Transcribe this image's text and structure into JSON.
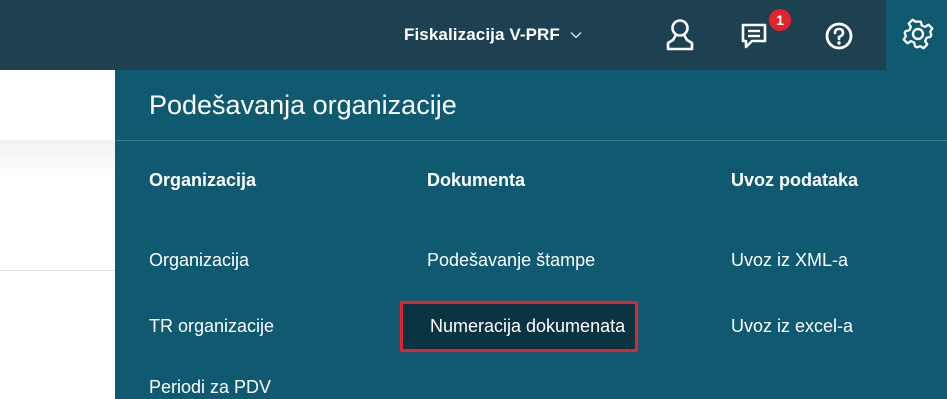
{
  "header": {
    "org_name": "Fiskalizacija V-PRF",
    "notification_count": "1"
  },
  "icons": {
    "user": "user-icon",
    "messages": "messages-icon",
    "help": "help-icon",
    "settings": "gear-icon",
    "org_dropdown": "chevron-down-icon"
  },
  "colors": {
    "topbar": "#1d4150",
    "panel": "#0f5a70",
    "highlight_bg": "#0a3441",
    "highlight_border": "#e3222b",
    "badge": "#e3222b"
  },
  "panel": {
    "title": "Podešavanja organizacije",
    "columns": [
      {
        "heading": "Organizacija",
        "items": [
          "Organizacija",
          "TR organizacije",
          "Periodi za PDV"
        ]
      },
      {
        "heading": "Dokumenta",
        "items": [
          "Podešavanje štampe",
          "Numeracija dokumenata"
        ]
      },
      {
        "heading": "Uvoz podataka",
        "items": [
          "Uvoz iz XML-a",
          "Uvoz iz excel-a"
        ]
      }
    ]
  }
}
